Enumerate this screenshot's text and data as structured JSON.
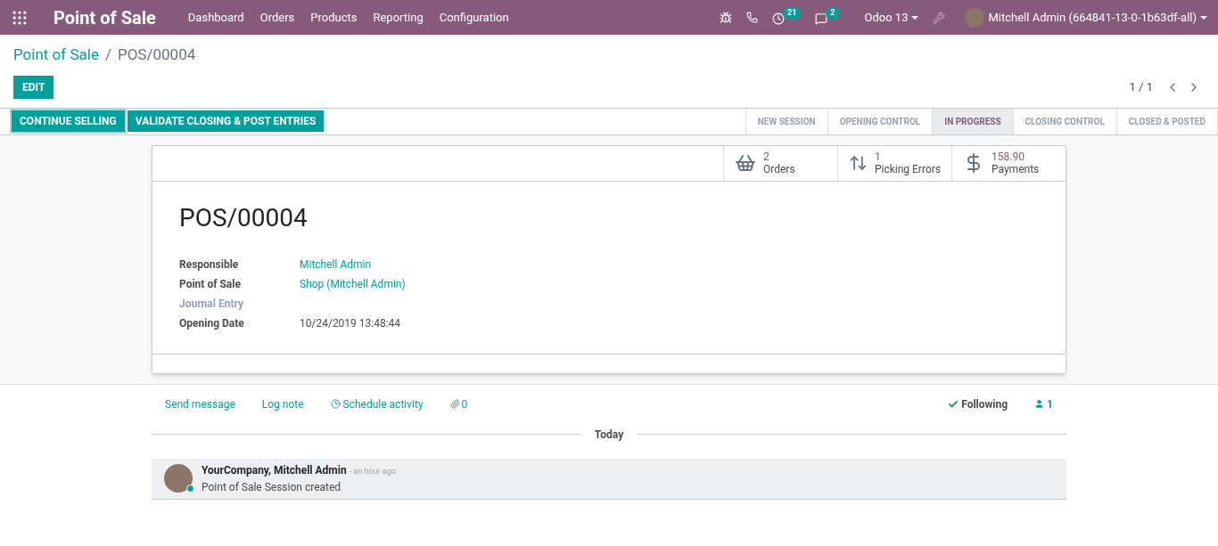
{
  "navbar": {
    "app_title": "Point of Sale",
    "menu": [
      "Dashboard",
      "Orders",
      "Products",
      "Reporting",
      "Configuration"
    ],
    "activity_count": "21",
    "message_count": "2",
    "database": "Odoo 13",
    "user": "Mitchell Admin (664841-13-0-1b63df-all)"
  },
  "breadcrumb": {
    "parent": "Point of Sale",
    "separator": "/",
    "current": "POS/00004"
  },
  "edit_button": "EDIT",
  "pager": "1 / 1",
  "action_buttons": [
    {
      "label": "CONTINUE SELLING",
      "selected": true
    },
    {
      "label": "VALIDATE CLOSING & POST ENTRIES",
      "selected": false
    }
  ],
  "stages": [
    {
      "label": "NEW SESSION",
      "selected": false
    },
    {
      "label": "OPENING CONTROL",
      "selected": false
    },
    {
      "label": "IN PROGRESS",
      "selected": true
    },
    {
      "label": "CLOSING CONTROL",
      "selected": false
    },
    {
      "label": "CLOSED & POSTED",
      "selected": false
    }
  ],
  "smart_buttons": [
    {
      "kind": "basket",
      "value": "2",
      "label": "Orders"
    },
    {
      "kind": "arrows",
      "value": "1",
      "label": "Picking Errors"
    },
    {
      "kind": "dollar",
      "value": "158.90",
      "label": "Payments"
    }
  ],
  "title": "POS/00004",
  "fields": [
    {
      "label": "Responsible",
      "value": "Mitchell Admin",
      "kind": "link",
      "disabled": false
    },
    {
      "label": "Point of Sale",
      "value": "Shop (Mitchell Admin)",
      "kind": "link",
      "disabled": false
    },
    {
      "label": "Journal Entry",
      "kind": "empty",
      "disabled": true
    },
    {
      "label": "Opening Date",
      "value": "10/24/2019 13:48:44",
      "kind": "text",
      "disabled": false
    }
  ],
  "chatter": {
    "send_message": "Send message",
    "log_note": "Log note",
    "schedule_activity": "Schedule activity",
    "attachments": "0",
    "following": "Following",
    "followers": "1",
    "date_separator": "Today",
    "messages": [
      {
        "author": "YourCompany, Mitchell Admin",
        "time": "- an hour ago",
        "body": "Point of Sale Session created"
      }
    ]
  }
}
